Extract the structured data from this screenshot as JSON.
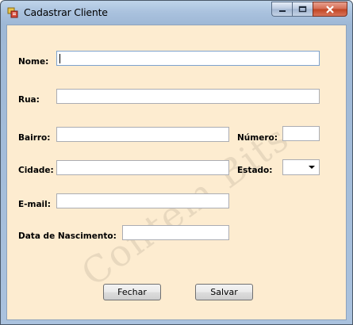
{
  "window": {
    "title": "Cadastrar Cliente",
    "icon": "form-app-icon",
    "controls": {
      "minimize": "minimize-icon",
      "maximize": "maximize-icon",
      "close": "close-icon"
    }
  },
  "form": {
    "nome": {
      "label": "Nome:",
      "value": ""
    },
    "rua": {
      "label": "Rua:",
      "value": ""
    },
    "bairro": {
      "label": "Bairro:",
      "value": ""
    },
    "numero": {
      "label": "Número:",
      "value": ""
    },
    "cidade": {
      "label": "Cidade:",
      "value": ""
    },
    "estado": {
      "label": "Estado:",
      "value": ""
    },
    "email": {
      "label": "E-mail:",
      "value": ""
    },
    "nascimento": {
      "label": "Data de Nascimento:",
      "value": ""
    }
  },
  "buttons": {
    "fechar": "Fechar",
    "salvar": "Salvar"
  },
  "watermark": "Contém Bits",
  "colors": {
    "client_background": "#fdecd0",
    "titlebar": "#aac2de",
    "close_button": "#c04422"
  }
}
